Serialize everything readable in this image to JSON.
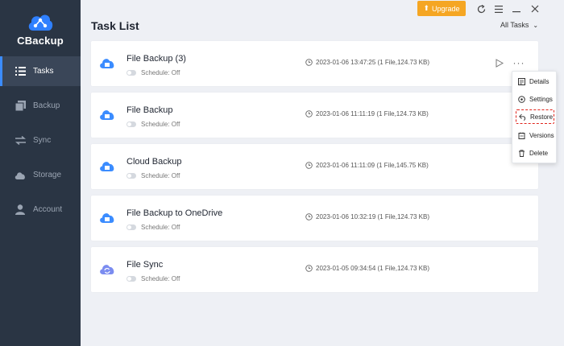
{
  "app": {
    "logo_text": "CBackup",
    "brand_color": "#2f80ff",
    "sidebar_color": "#2a3544"
  },
  "nav": [
    {
      "label": "Tasks",
      "icon": "list-icon",
      "active": true
    },
    {
      "label": "Backup",
      "icon": "backup-icon",
      "active": false
    },
    {
      "label": "Sync",
      "icon": "sync-icon",
      "active": false
    },
    {
      "label": "Storage",
      "icon": "cloud-icon",
      "active": false
    },
    {
      "label": "Account",
      "icon": "user-icon",
      "active": false
    }
  ],
  "titlebar": {
    "upgrade_label": "Upgrade",
    "upgrade_color": "#f5a623"
  },
  "header": {
    "title": "Task List",
    "filter_label": "All Tasks"
  },
  "tasks": [
    {
      "name": "File Backup (3)",
      "schedule": "Schedule: Off",
      "meta": "2023-01-06 13:47:25 (1 File,124.73 KB)",
      "icon": "cloud-backup-icon"
    },
    {
      "name": "File Backup",
      "schedule": "Schedule: Off",
      "meta": "2023-01-06 11:11:19 (1 File,124.73 KB)",
      "icon": "cloud-backup-icon"
    },
    {
      "name": "Cloud Backup",
      "schedule": "Schedule: Off",
      "meta": "2023-01-06 11:11:09 (1 File,145.75 KB)",
      "icon": "cloud-backup-icon"
    },
    {
      "name": "File Backup to OneDrive",
      "schedule": "Schedule: Off",
      "meta": "2023-01-06 10:32:19 (1 File,124.73 KB)",
      "icon": "cloud-backup-icon"
    },
    {
      "name": "File Sync",
      "schedule": "Schedule: Off",
      "meta": "2023-01-05 09:34:54 (1 File,124.73 KB)",
      "icon": "cloud-sync-icon"
    }
  ],
  "context_menu": [
    {
      "label": "Details",
      "icon": "details-icon",
      "highlighted": false
    },
    {
      "label": "Settings",
      "icon": "settings-icon",
      "highlighted": false
    },
    {
      "label": "Restore",
      "icon": "restore-icon",
      "highlighted": true
    },
    {
      "label": "Versions",
      "icon": "versions-icon",
      "highlighted": false
    },
    {
      "label": "Delete",
      "icon": "delete-icon",
      "highlighted": false
    }
  ]
}
